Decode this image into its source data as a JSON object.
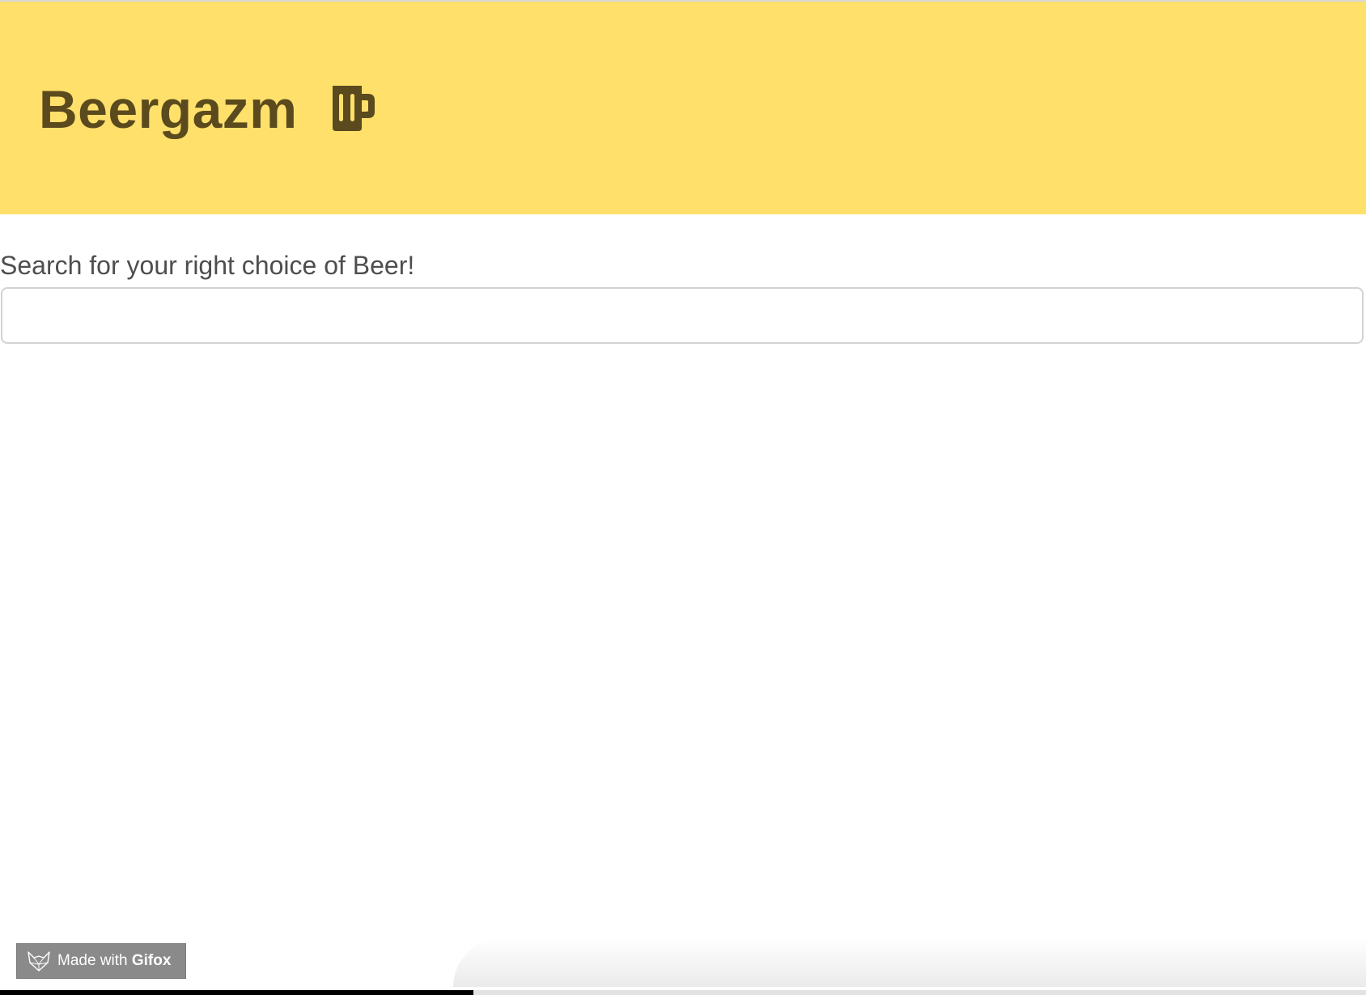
{
  "header": {
    "title": "Beergazm",
    "icon": "beer-mug-icon",
    "background_color": "#fee06b",
    "text_color": "#5b4a1d"
  },
  "search": {
    "label": "Search for your right choice of Beer!",
    "value": "",
    "placeholder": ""
  },
  "watermark": {
    "prefix": "Made with ",
    "brand": "Gifox",
    "icon": "fox-icon"
  }
}
